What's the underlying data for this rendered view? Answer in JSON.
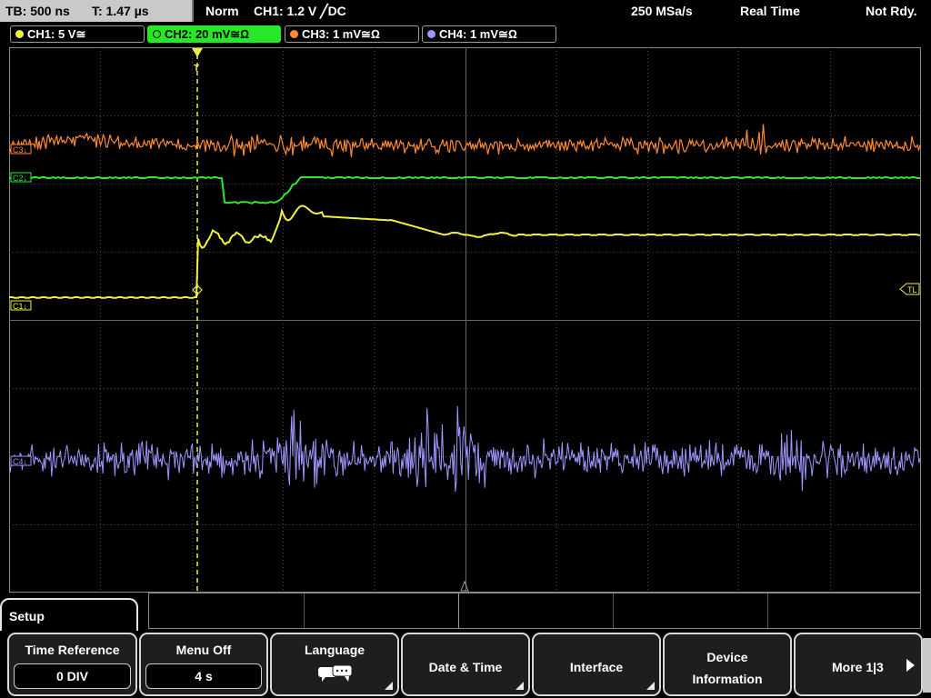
{
  "status_bar": {
    "timebase": "TB: 500 ns",
    "trigger_time": "T: 1.47 µs",
    "trigger_mode": "Norm",
    "trigger_source": "CH1: 1.2 V ╱DC",
    "sample_rate": "250 MSa/s",
    "acquisition": "Real Time",
    "state": "Not Rdy."
  },
  "channels": [
    {
      "label": "CH1: 5 V≅",
      "color": "#f0f040",
      "active": false
    },
    {
      "label": "CH2: 20 mV≅Ω",
      "color": "#2ee82e",
      "active": true
    },
    {
      "label": "CH3: 1 mV≅Ω",
      "color": "#ff8a33",
      "active": false
    },
    {
      "label": "CH4: 1 mV≅Ω",
      "color": "#9e98ff",
      "active": false
    }
  ],
  "markers": {
    "ch1": "C1↓",
    "ch2": "C2↓",
    "ch3": "C3↓",
    "ch4": "C4↓",
    "trigger_level": "TL",
    "trigger_position": "T"
  },
  "menu": {
    "title": "Setup",
    "time_reference": {
      "label": "Time Reference",
      "value": "0 DIV"
    },
    "menu_off": {
      "label": "Menu Off",
      "value": "4 s"
    },
    "language": {
      "label": "Language",
      "icon": "speech-bubble-icon"
    },
    "date_time": {
      "label": "Date & Time"
    },
    "interface": {
      "label": "Interface"
    },
    "device_info": {
      "label_line1": "Device",
      "label_line2": "Information"
    },
    "more": {
      "label": "More 1|3"
    }
  },
  "colors": {
    "ch1": "#f0f040",
    "ch2": "#2ee82e",
    "ch3": "#ff8a33",
    "ch4": "#9e98ff",
    "grid": "#4a4a4a",
    "frame": "#8a8a8a",
    "trigger_line": "#f0f040"
  }
}
